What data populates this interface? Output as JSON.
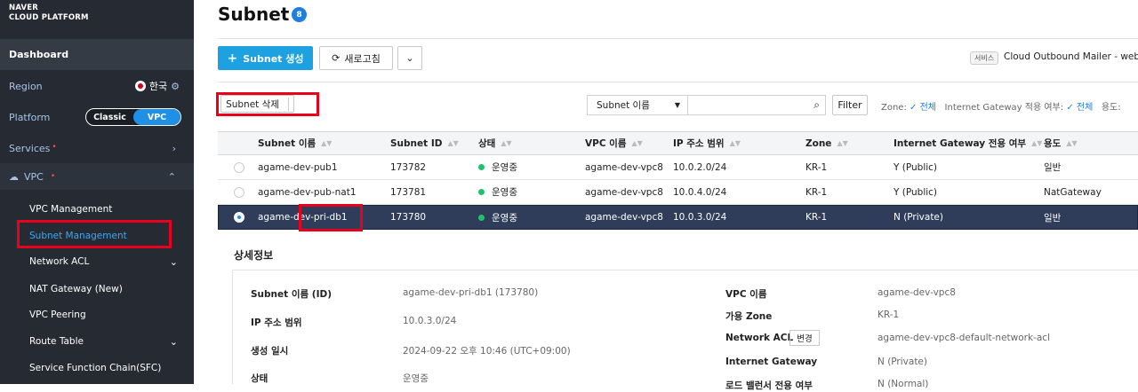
{
  "brand": {
    "line1": "NAVER",
    "line2": "CLOUD PLATFORM"
  },
  "sidebar": {
    "dashboard": "Dashboard",
    "region_label": "Region",
    "region_value": "한국",
    "platform_label": "Platform",
    "platform_options": [
      "Classic",
      "VPC"
    ],
    "platform_selected": "VPC",
    "services": "Services",
    "vpc": "VPC",
    "items": [
      {
        "label": "VPC Management"
      },
      {
        "label": "Subnet Management",
        "active": true
      },
      {
        "label": "Network ACL"
      },
      {
        "label": "NAT Gateway (New)"
      },
      {
        "label": "VPC Peering"
      },
      {
        "label": "Route Table"
      },
      {
        "label": "Service Function Chain(SFC)"
      }
    ]
  },
  "page": {
    "title": "Subnet",
    "count": "8"
  },
  "toolbar": {
    "create": "Subnet 생성",
    "refresh": "새로고침",
    "service_tag": "서비스",
    "service_text": "Cloud Outbound Mailer - web ec"
  },
  "filters": {
    "delete": "Subnet 삭제",
    "select_value": "Subnet 이름",
    "search_placeholder": "",
    "filter_btn": "Filter",
    "zone_label": "Zone:",
    "zone_value": "전체",
    "igw_label": "Internet Gateway 적용 여부:",
    "igw_value": "전체",
    "usage_label": "용도:"
  },
  "table": {
    "headers": [
      "Subnet 이름",
      "Subnet ID",
      "상태",
      "VPC 이름",
      "IP 주소 범위",
      "Zone",
      "Internet Gateway 전용 여부",
      "용도"
    ],
    "rows": [
      {
        "name": "agame-dev-pub1",
        "id": "173782",
        "status": "운영중",
        "vpc": "agame-dev-vpc8",
        "ip": "10.0.2.0/24",
        "zone": "KR-1",
        "igw": "Y (Public)",
        "usage": "일반",
        "selected": false
      },
      {
        "name": "agame-dev-pub-nat1",
        "id": "173781",
        "status": "운영중",
        "vpc": "agame-dev-vpc8",
        "ip": "10.0.4.0/24",
        "zone": "KR-1",
        "igw": "Y (Public)",
        "usage": "NatGateway",
        "selected": false
      },
      {
        "name": "agame-dev-pri-db1",
        "id": "173780",
        "status": "운영중",
        "vpc": "agame-dev-vpc8",
        "ip": "10.0.3.0/24",
        "zone": "KR-1",
        "igw": "N (Private)",
        "usage": "일반",
        "selected": true
      }
    ]
  },
  "detail": {
    "title": "상세정보",
    "left": [
      {
        "k": "Subnet 이름 (ID)",
        "v": "agame-dev-pri-db1 (173780)"
      },
      {
        "k": "IP 주소 범위",
        "v": "10.0.3.0/24"
      },
      {
        "k": "생성 일시",
        "v": "2024-09-22 오후 10:46 (UTC+09:00)"
      },
      {
        "k": "상태",
        "v": "운영중"
      }
    ],
    "right": [
      {
        "k": "VPC 이름",
        "v": "agame-dev-vpc8"
      },
      {
        "k": "가용 Zone",
        "v": "KR-1"
      },
      {
        "k": "Network ACL",
        "v": "agame-dev-vpc8-default-network-acl"
      },
      {
        "k": "Internet Gateway",
        "v": "N (Private)"
      },
      {
        "k": "로드 밸런서 전용 여부",
        "v": "N (Normal)"
      }
    ],
    "change_btn": "변경"
  },
  "colors": {
    "sidebar_bg": "#262b33",
    "primary": "#1da1e0",
    "selected_row": "#2f3d5a",
    "highlight_box": "#e8001c"
  }
}
